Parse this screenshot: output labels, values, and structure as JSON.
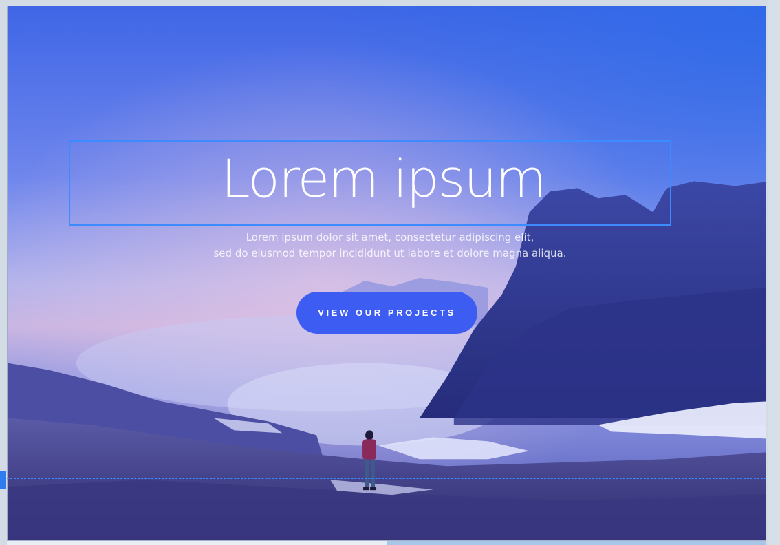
{
  "hero": {
    "title": "Lorem ipsum",
    "subtitle_line1": "Lorem ipsum dolor sit amet, consectetur adipiscing elit,",
    "subtitle_line2": "sed do eiusmod tempor incididunt ut labore et dolore magna aliqua.",
    "cta_label": "VIEW OUR PROJECTS",
    "background_icon": "mountain-landscape-photo"
  },
  "colors": {
    "accent": "#3d5cf2",
    "selection": "#3d8bff",
    "sky_top": "#3f62e4",
    "sky_glow": "#c9b7e6"
  }
}
